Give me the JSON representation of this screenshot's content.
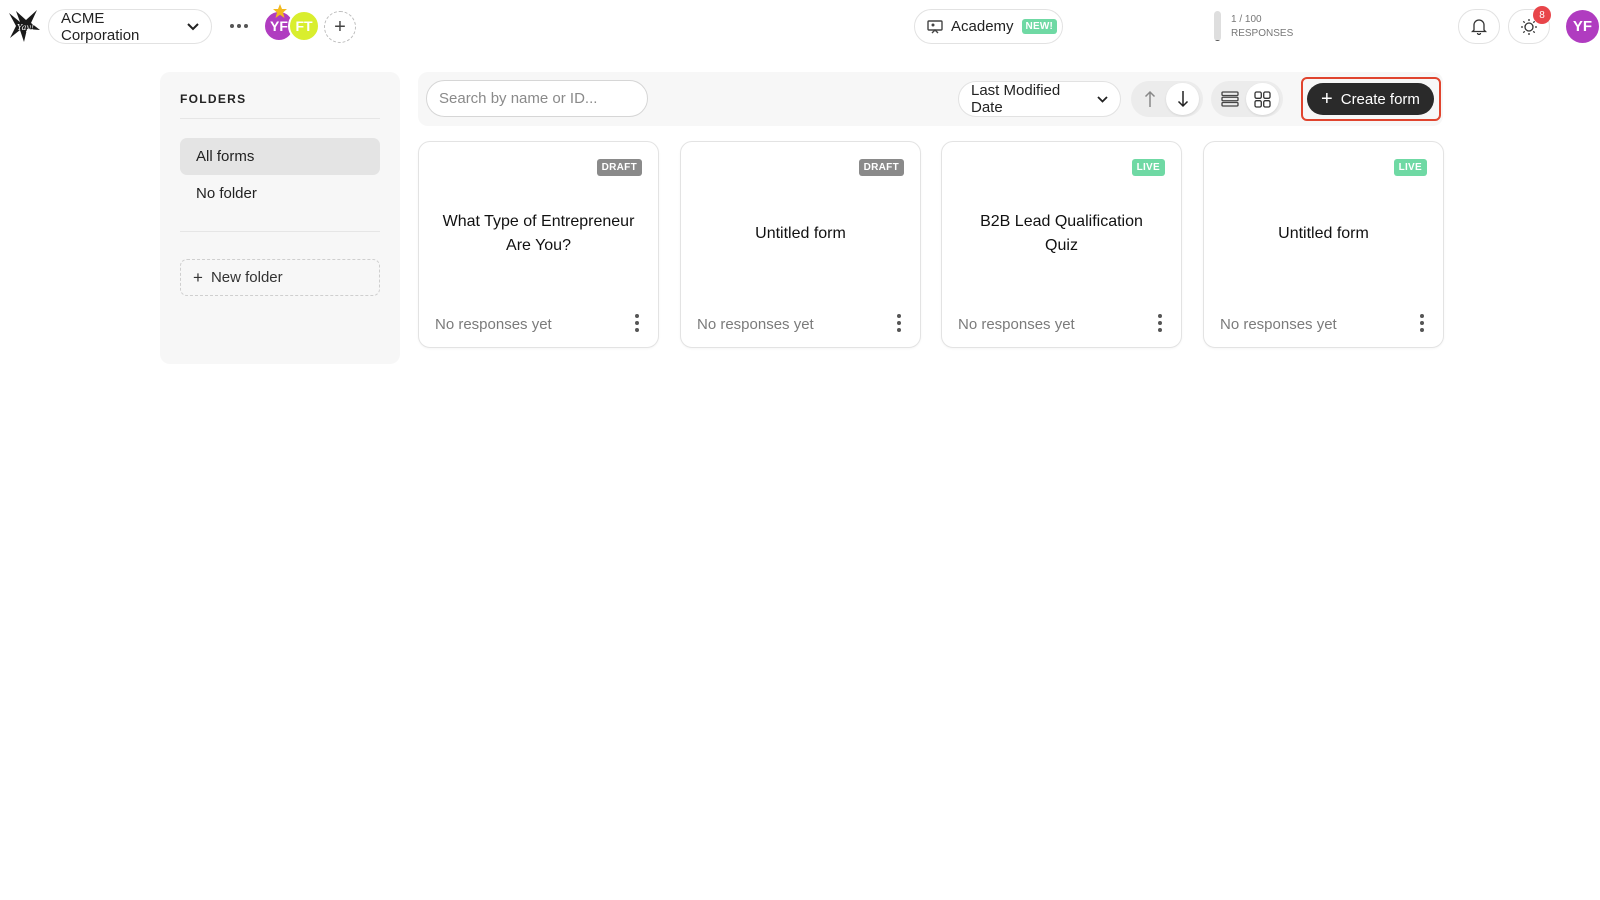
{
  "header": {
    "workspace_name": "ACME Corporation",
    "members": [
      {
        "initials": "YF",
        "color": "#b03cc0"
      },
      {
        "initials": "FT",
        "color": "#d9ee2e"
      }
    ],
    "academy_label": "Academy",
    "academy_badge": "NEW!",
    "responses_count": "1 / 100",
    "responses_label": "RESPONSES",
    "responses_fraction": 0.01,
    "notification_count": "8",
    "user_initials": "YF",
    "accent_color": "#b03cc0"
  },
  "sidebar": {
    "heading": "FOLDERS",
    "items": [
      {
        "label": "All forms",
        "active": true
      },
      {
        "label": "No folder",
        "active": false
      }
    ],
    "new_folder_label": "New folder"
  },
  "toolbar": {
    "search_placeholder": "Search by name or ID...",
    "sort_label": "Last Modified Date",
    "create_label": "Create form",
    "create_highlight_color": "#e0442e"
  },
  "forms": [
    {
      "title": "What Type of Entrepreneur Are You?",
      "status": "DRAFT",
      "responses": "No responses yet"
    },
    {
      "title": "Untitled form",
      "status": "DRAFT",
      "responses": "No responses yet"
    },
    {
      "title": "B2B Lead Qualification Quiz",
      "status": "LIVE",
      "responses": "No responses yet"
    },
    {
      "title": "Untitled form",
      "status": "LIVE",
      "responses": "No responses yet"
    }
  ]
}
